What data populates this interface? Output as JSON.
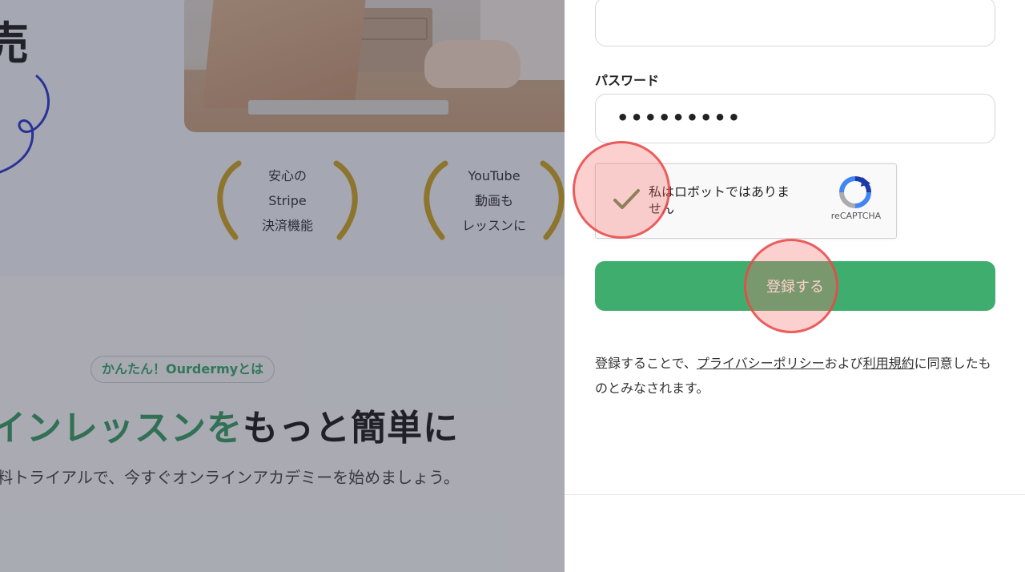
{
  "background": {
    "hero_heading": "売",
    "awards": [
      {
        "lines": [
          "安心の",
          "Stripe",
          "決済機能"
        ]
      },
      {
        "lines": [
          "YouTube",
          "動画も",
          "レッスンに"
        ]
      }
    ],
    "tag": "かんたん！Ourdermyとは",
    "headline_green": "インレッスンを",
    "headline_dark": "もっと簡単に",
    "lead": "料トライアルで、今すぐオンラインアカデミーを始めましょう。"
  },
  "form": {
    "email_value": "",
    "password_label": "パスワード",
    "password_value": "•••••••••",
    "captcha": {
      "text": "私はロボットではありません",
      "brand": "reCAPTCHA",
      "checked": true
    },
    "submit_label": "登録する",
    "terms": {
      "prefix": "登録することで、",
      "privacy_link": "プライバシーポリシー",
      "middle": "および",
      "tos_link": "利用規約",
      "suffix": "に同意したものとみなされます。"
    }
  },
  "colors": {
    "primary_button": "#3fad6e",
    "accent_green": "#3b9a63",
    "click_highlight": "#e84848"
  }
}
